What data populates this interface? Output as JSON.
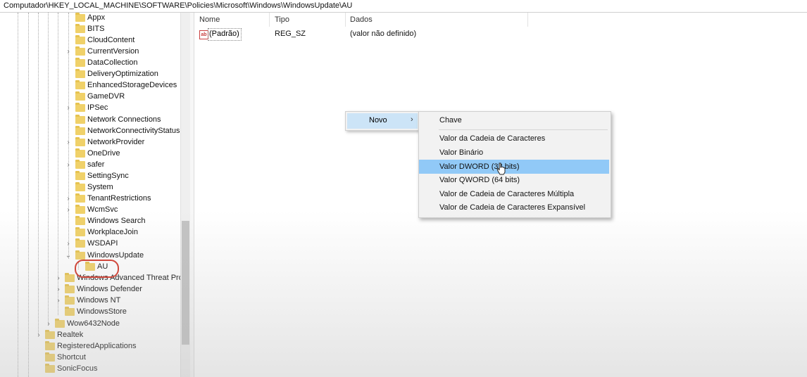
{
  "address_bar": {
    "path": "Computador\\HKEY_LOCAL_MACHINE\\SOFTWARE\\Policies\\Microsoft\\Windows\\WindowsUpdate\\AU"
  },
  "tree": {
    "items": [
      {
        "label": "Appx",
        "expand": ""
      },
      {
        "label": "BITS",
        "expand": ""
      },
      {
        "label": "CloudContent",
        "expand": ""
      },
      {
        "label": "CurrentVersion",
        "expand": "›"
      },
      {
        "label": "DataCollection",
        "expand": ""
      },
      {
        "label": "DeliveryOptimization",
        "expand": ""
      },
      {
        "label": "EnhancedStorageDevices",
        "expand": ""
      },
      {
        "label": "GameDVR",
        "expand": ""
      },
      {
        "label": "IPSec",
        "expand": "›"
      },
      {
        "label": "Network Connections",
        "expand": ""
      },
      {
        "label": "NetworkConnectivityStatusI",
        "expand": ""
      },
      {
        "label": "NetworkProvider",
        "expand": "›"
      },
      {
        "label": "OneDrive",
        "expand": ""
      },
      {
        "label": "safer",
        "expand": "›"
      },
      {
        "label": "SettingSync",
        "expand": ""
      },
      {
        "label": "System",
        "expand": ""
      },
      {
        "label": "TenantRestrictions",
        "expand": "›"
      },
      {
        "label": "WcmSvc",
        "expand": "›"
      },
      {
        "label": "Windows Search",
        "expand": ""
      },
      {
        "label": "WorkplaceJoin",
        "expand": ""
      },
      {
        "label": "WSDAPI",
        "expand": "›"
      },
      {
        "label": "WindowsUpdate",
        "expand": "⌄"
      },
      {
        "label": "AU",
        "expand": ""
      },
      {
        "label": "Windows Advanced Threat Pro",
        "expand": "›"
      },
      {
        "label": "Windows Defender",
        "expand": "›"
      },
      {
        "label": "Windows NT",
        "expand": "›"
      },
      {
        "label": "WindowsStore",
        "expand": ""
      },
      {
        "label": "Wow6432Node",
        "expand": "›"
      },
      {
        "label": "Realtek",
        "expand": "›"
      },
      {
        "label": "RegisteredApplications",
        "expand": ""
      },
      {
        "label": "Shortcut",
        "expand": ""
      },
      {
        "label": "SonicFocus",
        "expand": ""
      }
    ]
  },
  "list": {
    "headers": {
      "name": "Nome",
      "type": "Tipo",
      "data": "Dados"
    },
    "rows": [
      {
        "icon": "ab",
        "name": "(Padrão)",
        "type": "REG_SZ",
        "data": "(valor não definido)"
      }
    ]
  },
  "context_menu": {
    "new_label": "Novo",
    "submenu_arrow": "›",
    "submenu": [
      "Chave",
      "Valor da Cadeia de Caracteres",
      "Valor Binário",
      "Valor DWORD (32 bits)",
      "Valor QWORD (64 bits)",
      "Valor de Cadeia de Caracteres Múltipla",
      "Valor de Cadeia de Caracteres Expansível"
    ]
  },
  "colors": {
    "menu_highlight": "#91c9f7",
    "annotation_circle": "#d3392b",
    "folder": "#f0d169"
  }
}
